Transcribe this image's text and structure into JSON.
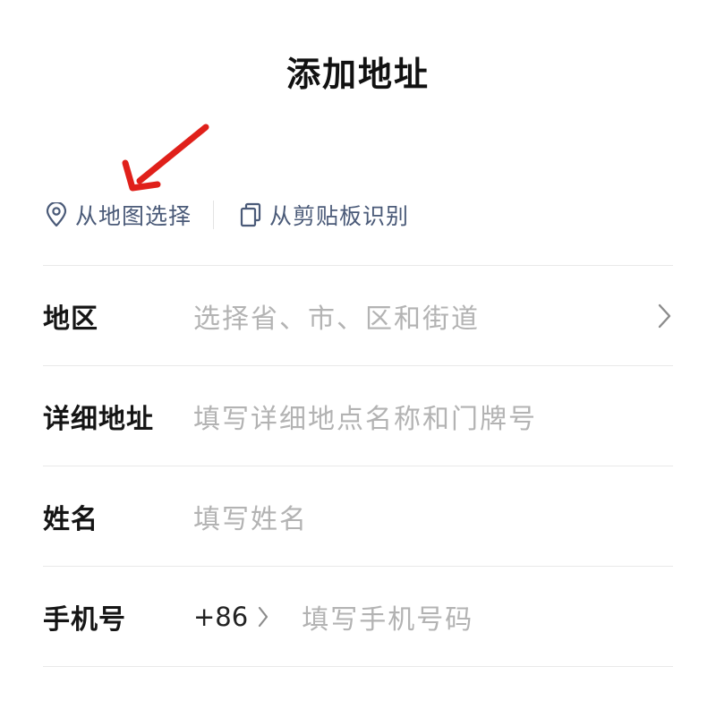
{
  "header": {
    "title": "添加地址"
  },
  "quick_actions": {
    "map_select": {
      "label": "从地图选择",
      "icon": "location-pin-icon"
    },
    "clipboard": {
      "label": "从剪贴板识别",
      "icon": "copy-icon"
    }
  },
  "form": {
    "region": {
      "label": "地区",
      "placeholder": "选择省、市、区和街道",
      "icon": "chevron-right-icon"
    },
    "address": {
      "label": "详细地址",
      "placeholder": "填写详细地点名称和门牌号"
    },
    "name": {
      "label": "姓名",
      "placeholder": "填写姓名"
    },
    "phone": {
      "label": "手机号",
      "country_code": "+86",
      "placeholder": "填写手机号码"
    }
  },
  "colors": {
    "accent": "#4a5a78",
    "placeholder": "#b3b3b3",
    "annotation_arrow": "#e0201a",
    "divider": "#e9e9e9"
  }
}
